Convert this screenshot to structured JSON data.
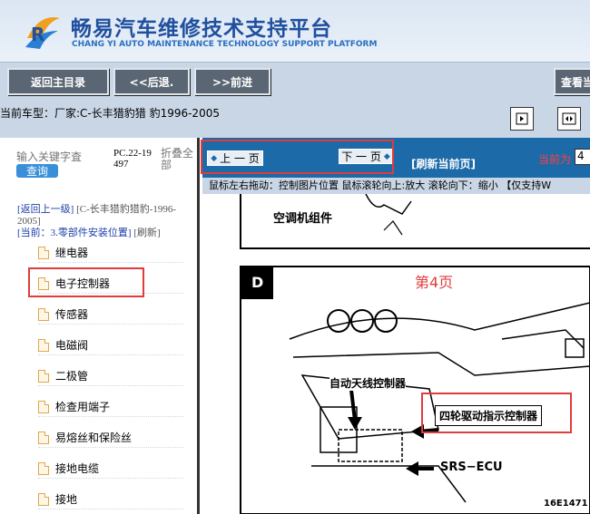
{
  "header": {
    "title": "畅易汽车维修技术支持平台",
    "subtitle": "CHANG YI AUTO MAINTENANCE TECHNOLOGY SUPPORT PLATFORM"
  },
  "nav": {
    "home": "返回主目录",
    "back": "<<后退.",
    "forward": ">>前进",
    "view": "查看当"
  },
  "vehicle": {
    "label": "当前车型：厂家:C-长丰猎豹猎 豹1996-2005"
  },
  "search": {
    "placeholder": "输入关键字査",
    "query": "查询",
    "code": "PC.22-19497",
    "collapse_all": "折叠全部"
  },
  "crumb": {
    "back": "[返回上一级]",
    "vehicle": "[C-长丰猎豹猎豹-1996-2005]",
    "current_prefix": "[当前：",
    "current": "3.零部件安装位置]",
    "refresh": "[刷新]"
  },
  "tree": {
    "items": [
      {
        "label": "继电器"
      },
      {
        "label": "电子控制器"
      },
      {
        "label": "传感器"
      },
      {
        "label": "电磁阀"
      },
      {
        "label": "二极管"
      },
      {
        "label": "检查用端子"
      },
      {
        "label": "易熔丝和保险丝"
      },
      {
        "label": "接地电缆"
      },
      {
        "label": "接地"
      }
    ]
  },
  "pager": {
    "prev": "上 一 页",
    "next": "下 一 页",
    "refresh": "[刷新当前页]",
    "current_label": "当前为",
    "page_value": "4"
  },
  "hint": "鼠标左右拖动：控制图片位置  鼠标滚轮向上:放大  滚轮向下：缩小 【仅支持W",
  "diagram": {
    "label_top": "空调机组件",
    "label_d": "D",
    "page_num": "第4页",
    "label_auto_antenna": "自动天线控制器",
    "label_4wd": "四轮驱动指示控制器",
    "label_srs": "SRS−ECU",
    "code": "16E1471"
  },
  "colors": {
    "header_bg": "#dbe6f3",
    "brand_blue": "#1f4f9e",
    "nav_bg": "#c9d6e6",
    "button_dark": "#5a6673",
    "page_bar": "#1c6aa8",
    "highlight_red": "#e03c3c"
  }
}
